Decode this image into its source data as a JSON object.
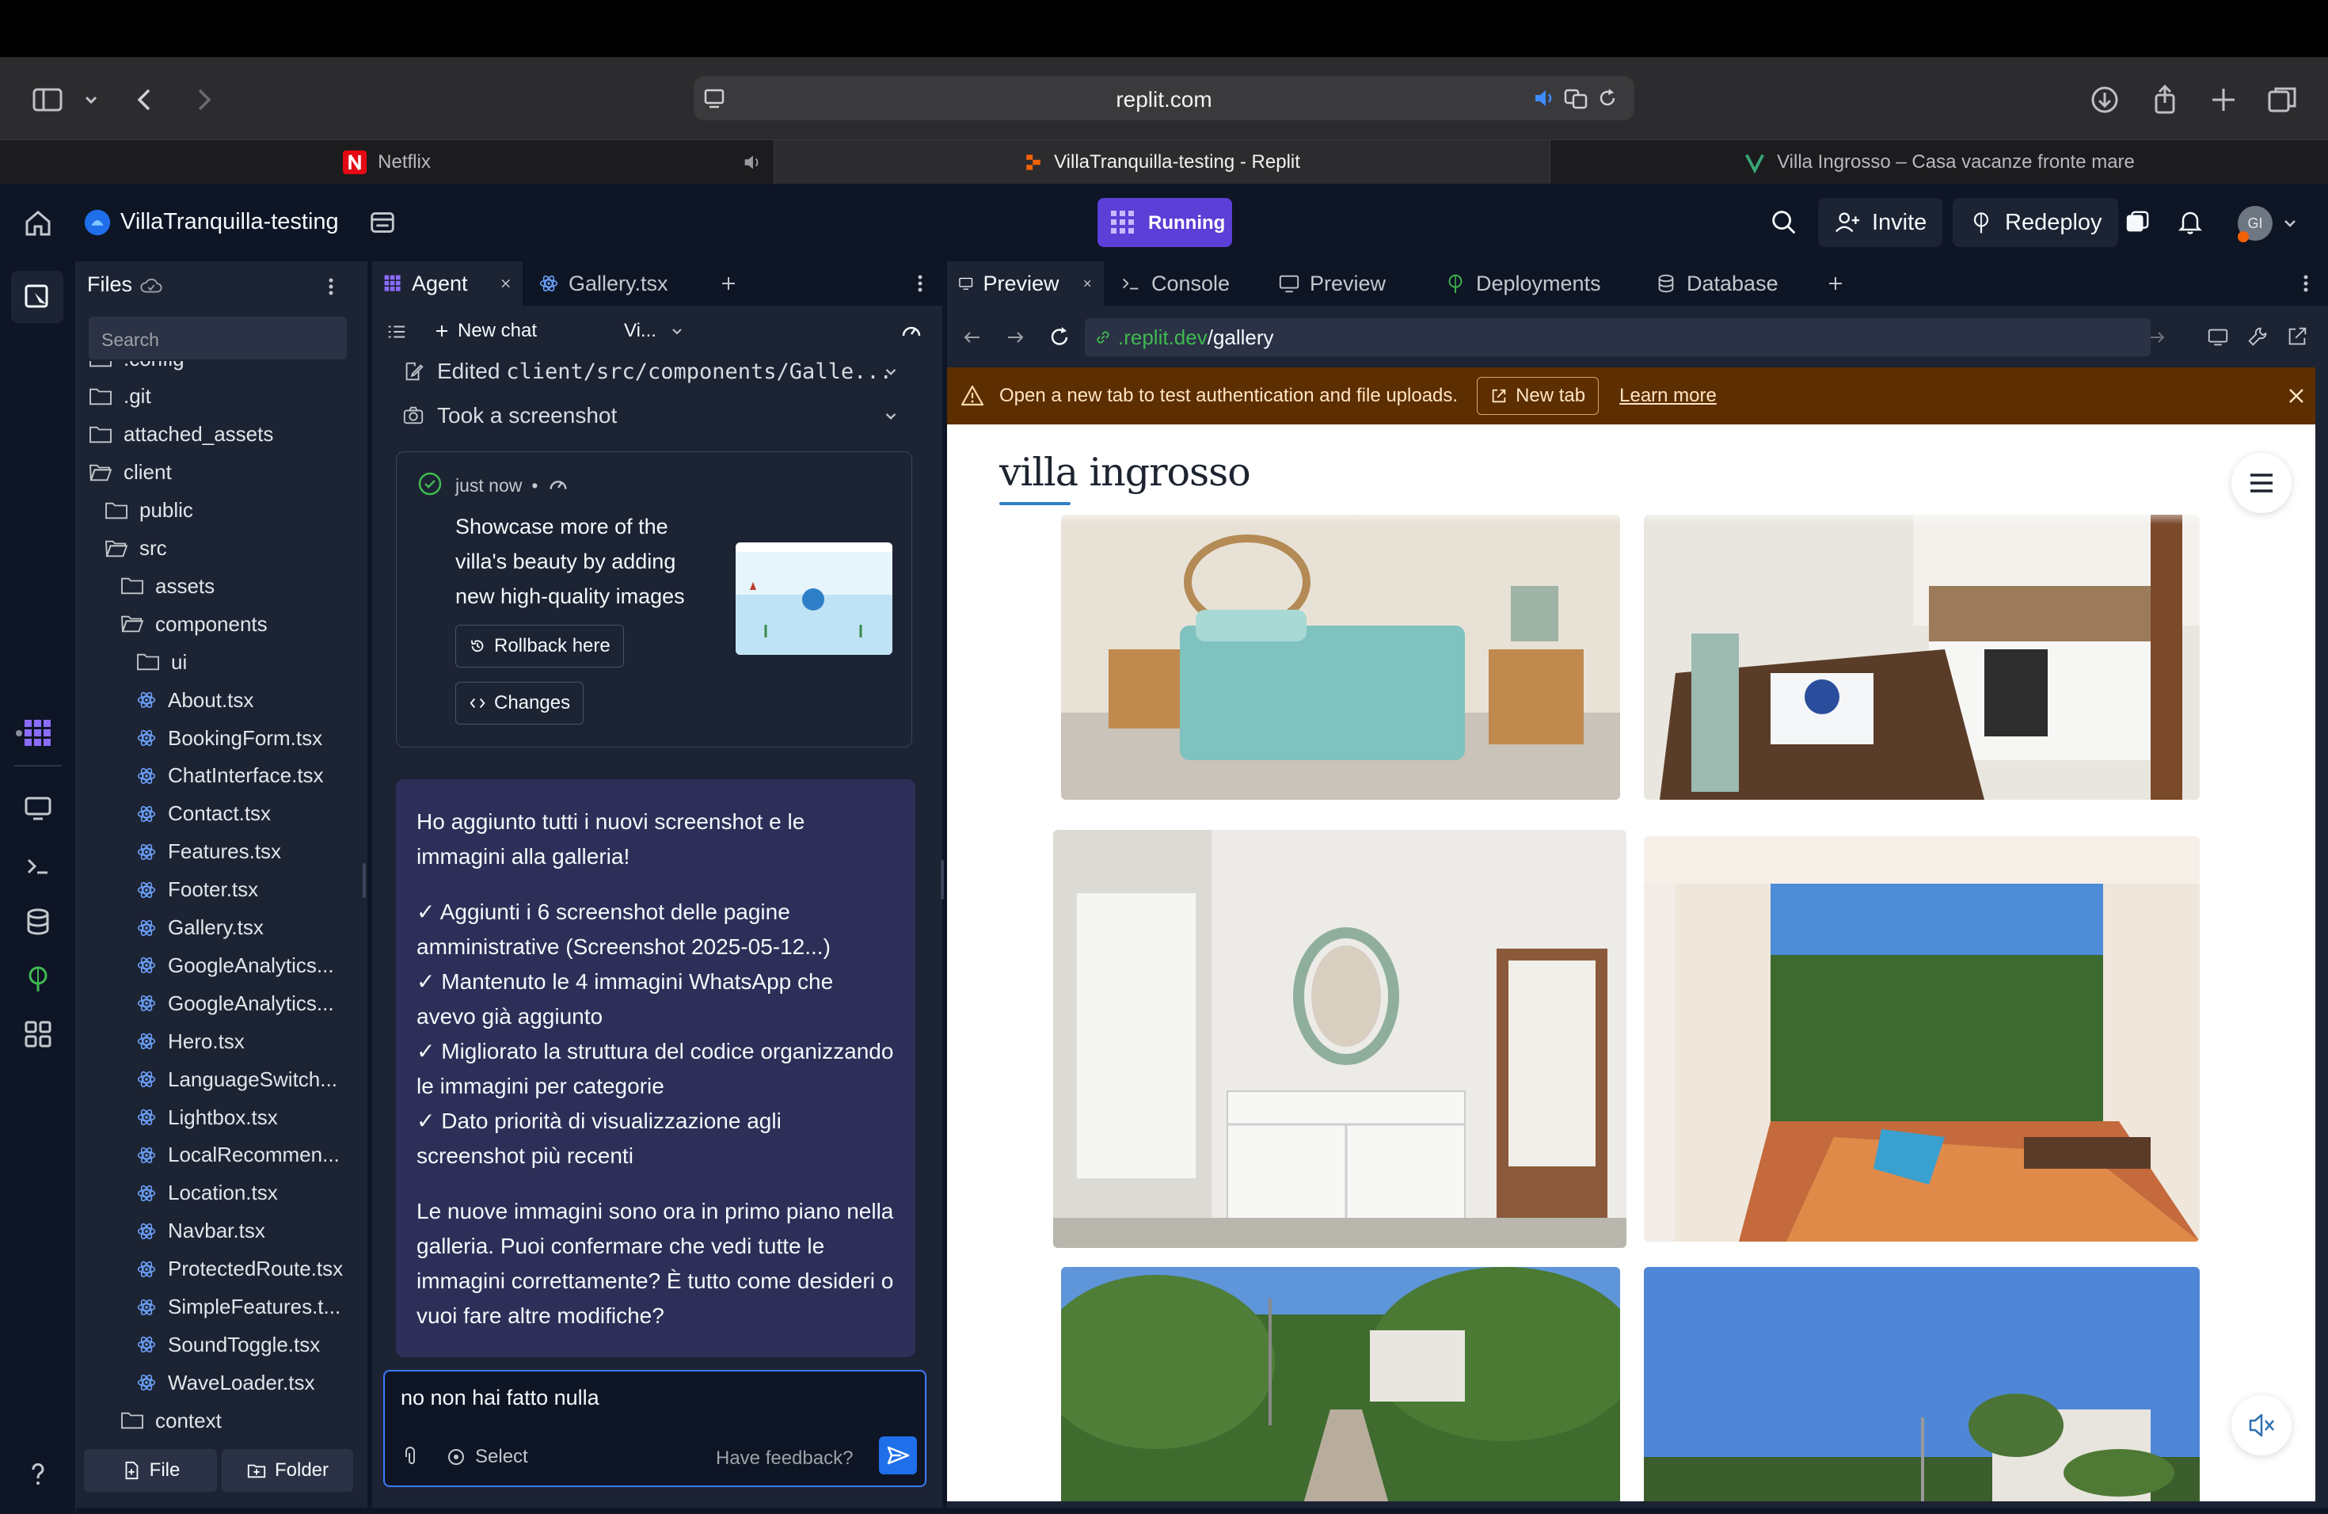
{
  "browser": {
    "url": "replit.com",
    "tabs": [
      {
        "label": "Netflix"
      },
      {
        "label": "VillaTranquilla-testing - Replit"
      },
      {
        "label": "Villa Ingrosso – Casa vacanze fronte mare"
      }
    ]
  },
  "header": {
    "project_name": "VillaTranquilla-testing",
    "run_status": "Running",
    "invite_label": "Invite",
    "redeploy_label": "Redeploy",
    "avatar_initials": "GI"
  },
  "files": {
    "title": "Files",
    "search_placeholder": "Search",
    "items": [
      {
        "label": ".config",
        "type": "folder"
      },
      {
        "label": ".git",
        "type": "folder"
      },
      {
        "label": "attached_assets",
        "type": "folder"
      },
      {
        "label": "client",
        "type": "folder-open"
      },
      {
        "label": "public",
        "type": "folder"
      },
      {
        "label": "src",
        "type": "folder-open"
      },
      {
        "label": "assets",
        "type": "folder"
      },
      {
        "label": "components",
        "type": "folder-open"
      },
      {
        "label": "ui",
        "type": "folder"
      },
      {
        "label": "About.tsx",
        "type": "react"
      },
      {
        "label": "BookingForm.tsx",
        "type": "react"
      },
      {
        "label": "ChatInterface.tsx",
        "type": "react"
      },
      {
        "label": "Contact.tsx",
        "type": "react"
      },
      {
        "label": "Features.tsx",
        "type": "react"
      },
      {
        "label": "Footer.tsx",
        "type": "react"
      },
      {
        "label": "Gallery.tsx",
        "type": "react"
      },
      {
        "label": "GoogleAnalytics...",
        "type": "react"
      },
      {
        "label": "GoogleAnalytics...",
        "type": "react"
      },
      {
        "label": "Hero.tsx",
        "type": "react"
      },
      {
        "label": "LanguageSwitch...",
        "type": "react"
      },
      {
        "label": "Lightbox.tsx",
        "type": "react"
      },
      {
        "label": "LocalRecommen...",
        "type": "react"
      },
      {
        "label": "Location.tsx",
        "type": "react"
      },
      {
        "label": "Navbar.tsx",
        "type": "react"
      },
      {
        "label": "ProtectedRoute.tsx",
        "type": "react"
      },
      {
        "label": "SimpleFeatures.t...",
        "type": "react"
      },
      {
        "label": "SoundToggle.tsx",
        "type": "react"
      },
      {
        "label": "WaveLoader.tsx",
        "type": "react"
      },
      {
        "label": "context",
        "type": "folder"
      }
    ],
    "new_file_label": "File",
    "new_folder_label": "Folder"
  },
  "agent": {
    "tab_agent": "Agent",
    "tab_file": "Gallery.tsx",
    "new_chat_label": "New chat",
    "view_selector": "Vi...",
    "activity_edited_prefix": "Edited",
    "activity_edited_path": "client/src/components/Galle...",
    "activity_screenshot": "Took a screenshot",
    "checkpoint_time": "just now",
    "checkpoint_text": "Showcase more of the villa's beauty by adding new high-quality images",
    "rollback_label": "Rollback here",
    "changes_label": "Changes",
    "message_intro": "Ho aggiunto tutti i nuovi screenshot e le immagini alla galleria!",
    "message_bullets": [
      "✓ Aggiunti i 6 screenshot delle pagine amministrative (Screenshot 2025-05-12...)",
      "✓ Mantenuto le 4 immagini WhatsApp che avevo già aggiunto",
      "✓ Migliorato la struttura del codice organizzando le immagini per categorie",
      "✓ Dato priorità di visualizzazione agli screenshot più recenti"
    ],
    "message_outro": "Le nuove immagini sono ora in primo piano nella galleria. Puoi confermare che vedi tutte le immagini correttamente? È tutto come desideri o vuoi fare altre modifiche?",
    "input_value": "no non hai fatto nulla",
    "select_label": "Select",
    "feedback_label": "Have feedback?"
  },
  "webview": {
    "tabs": [
      {
        "label": "Preview"
      },
      {
        "label": "Console"
      },
      {
        "label": "Preview"
      },
      {
        "label": "Deployments"
      },
      {
        "label": "Database"
      }
    ],
    "url_host": ".replit.dev",
    "url_path": "/gallery",
    "banner_text": "Open a new tab to test authentication and file uploads.",
    "banner_newtab": "New tab",
    "banner_learnmore": "Learn more",
    "site_logo": "villa ingrosso"
  },
  "colors": {
    "running_bg": "#5b3fd6",
    "banner_bg": "#5c2e00",
    "message_bg": "#2d2f58",
    "accent_blue": "#3d7bfd"
  }
}
